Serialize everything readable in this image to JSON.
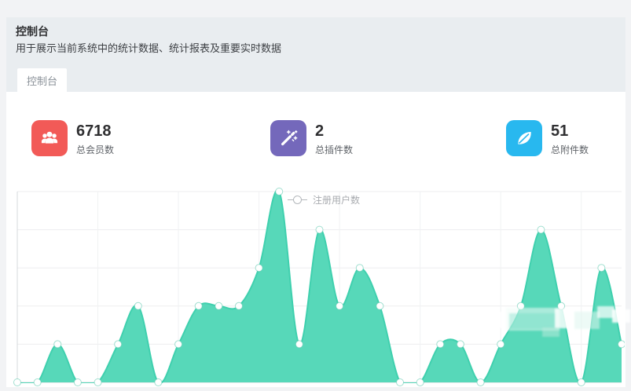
{
  "page": {
    "title": "控制台",
    "subtitle": "用于展示当前系统中的统计数据、统计报表及重要实时数据",
    "active_tab": "控制台"
  },
  "stats": [
    {
      "value": "6718",
      "label": "总会员数",
      "icon": "users-icon",
      "icon_color": "#f25a57"
    },
    {
      "value": "2",
      "label": "总插件数",
      "icon": "magic-wand-icon",
      "icon_color": "#7468bb"
    },
    {
      "value": "51",
      "label": "总附件数",
      "icon": "leaf-icon",
      "icon_color": "#28b8ef"
    }
  ],
  "chart_data": {
    "type": "area",
    "title": "",
    "smooth": true,
    "grid": true,
    "legend_position": "top-center",
    "axis_tick_labels_visible": false,
    "x_point_count": 31,
    "ylim": [
      0,
      5
    ],
    "series": [
      {
        "name": "注册用户数",
        "values": [
          0,
          0,
          1,
          0,
          0,
          1,
          2,
          0,
          1,
          2,
          2,
          2,
          3,
          5,
          1,
          4,
          2,
          3,
          2,
          0,
          0,
          1,
          1,
          0,
          1,
          2,
          4,
          2,
          0,
          3,
          1
        ]
      }
    ],
    "note": "y values in gridline units; axis tick labels are cropped out of the screenshot",
    "colors": {
      "area": "#57d8b9",
      "line": "#3fd0ae",
      "marker_fill": "#ffffff",
      "marker_border": "rgba(98,201,176,0.6)",
      "gridline": "#ededef",
      "axis": "#d6d9dc",
      "legend_text": "#a8abaf"
    }
  }
}
